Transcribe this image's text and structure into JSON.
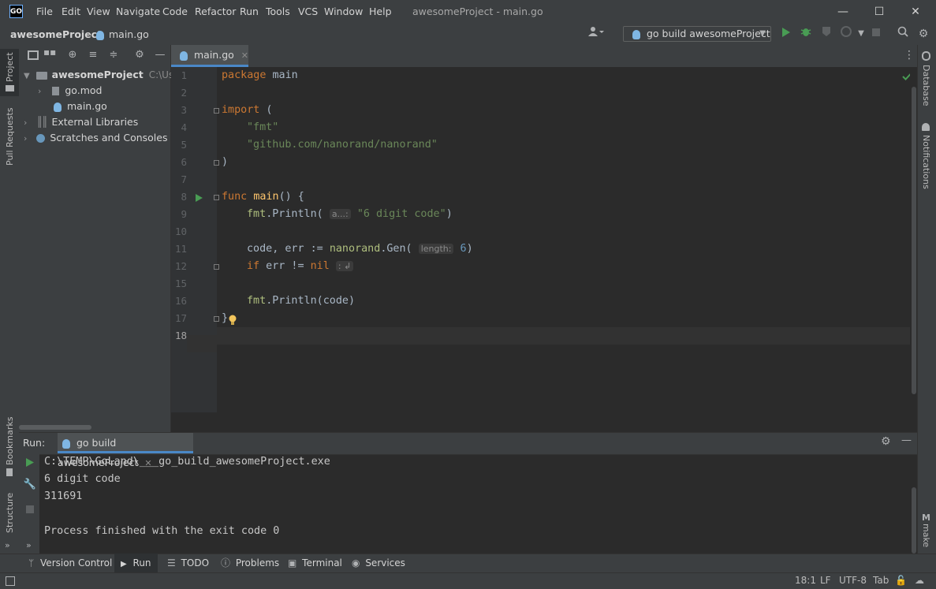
{
  "app": {
    "logo": "GO",
    "window_title": "awesomeProject - main.go"
  },
  "menu": [
    "File",
    "Edit",
    "View",
    "Navigate",
    "Code",
    "Refactor",
    "Run",
    "Tools",
    "VCS",
    "Window",
    "Help"
  ],
  "window_controls": {
    "minimize": "—",
    "maximize": "☐",
    "close": "✕"
  },
  "breadcrumb": {
    "project": "awesomeProject",
    "file": "main.go"
  },
  "run_config": {
    "label": "go build awesomeProject"
  },
  "left_strip": {
    "project": "Project",
    "pull_requests": "Pull Requests",
    "bookmarks": "Bookmarks",
    "structure": "Structure"
  },
  "right_strip": {
    "database": "Database",
    "notifications": "Notifications",
    "make": "make"
  },
  "project_tree": {
    "root": {
      "name": "awesomeProject",
      "path": "C:\\Users\\"
    },
    "items": [
      {
        "name": "go.mod"
      },
      {
        "name": "main.go"
      },
      {
        "name": "External Libraries"
      },
      {
        "name": "Scratches and Consoles"
      }
    ]
  },
  "editor": {
    "tab": "main.go",
    "line_numbers": [
      "1",
      "2",
      "3",
      "4",
      "5",
      "6",
      "7",
      "8",
      "9",
      "10",
      "11",
      "12",
      "15",
      "16",
      "17",
      "18"
    ],
    "tokens": {
      "l1_kw": "package",
      "l1_name": " main",
      "l3_kw": "import",
      "l3_paren": " (",
      "l4": "\"fmt\"",
      "l5": "\"github.com/nanorand/nanorand\"",
      "l6": ")",
      "l8_kw": "func",
      "l8_fn": "main",
      "l8_rest": "() {",
      "l9_pkg": "fmt",
      "l9_dot": ".Println(",
      "l9_hint": "a...:",
      "l9_str": "\"6 digit code\"",
      "l9_end": ")",
      "l11_vars": "code, err := ",
      "l11_pkg": "nanorand",
      "l11_call": ".Gen(",
      "l11_hint": "length:",
      "l11_num": "6",
      "l11_end": ")",
      "l12_kw": "if",
      "l12_mid": " err != ",
      "l12_nil": "nil",
      "l12_hint": ": ↲",
      "l16_pkg": "fmt",
      "l16_call": ".Println(code)",
      "l17": "}"
    }
  },
  "run_panel": {
    "label": "Run:",
    "tab": "go build awesomeProject",
    "output": [
      "C:\\TEMP\\GoLand\\___go_build_awesomeProject.exe",
      "6 digit code",
      "311691",
      "",
      "Process finished with the exit code 0"
    ]
  },
  "tool_windows": [
    "Version Control",
    "Run",
    "TODO",
    "Problems",
    "Terminal",
    "Services"
  ],
  "status_bar": {
    "position": "18:1",
    "line_sep": "LF",
    "encoding": "UTF-8",
    "indent": "Tab"
  },
  "colors": {
    "accent": "#4a88c7",
    "run_green": "#499c54",
    "keyword": "#cc7832",
    "string": "#6a8759"
  }
}
